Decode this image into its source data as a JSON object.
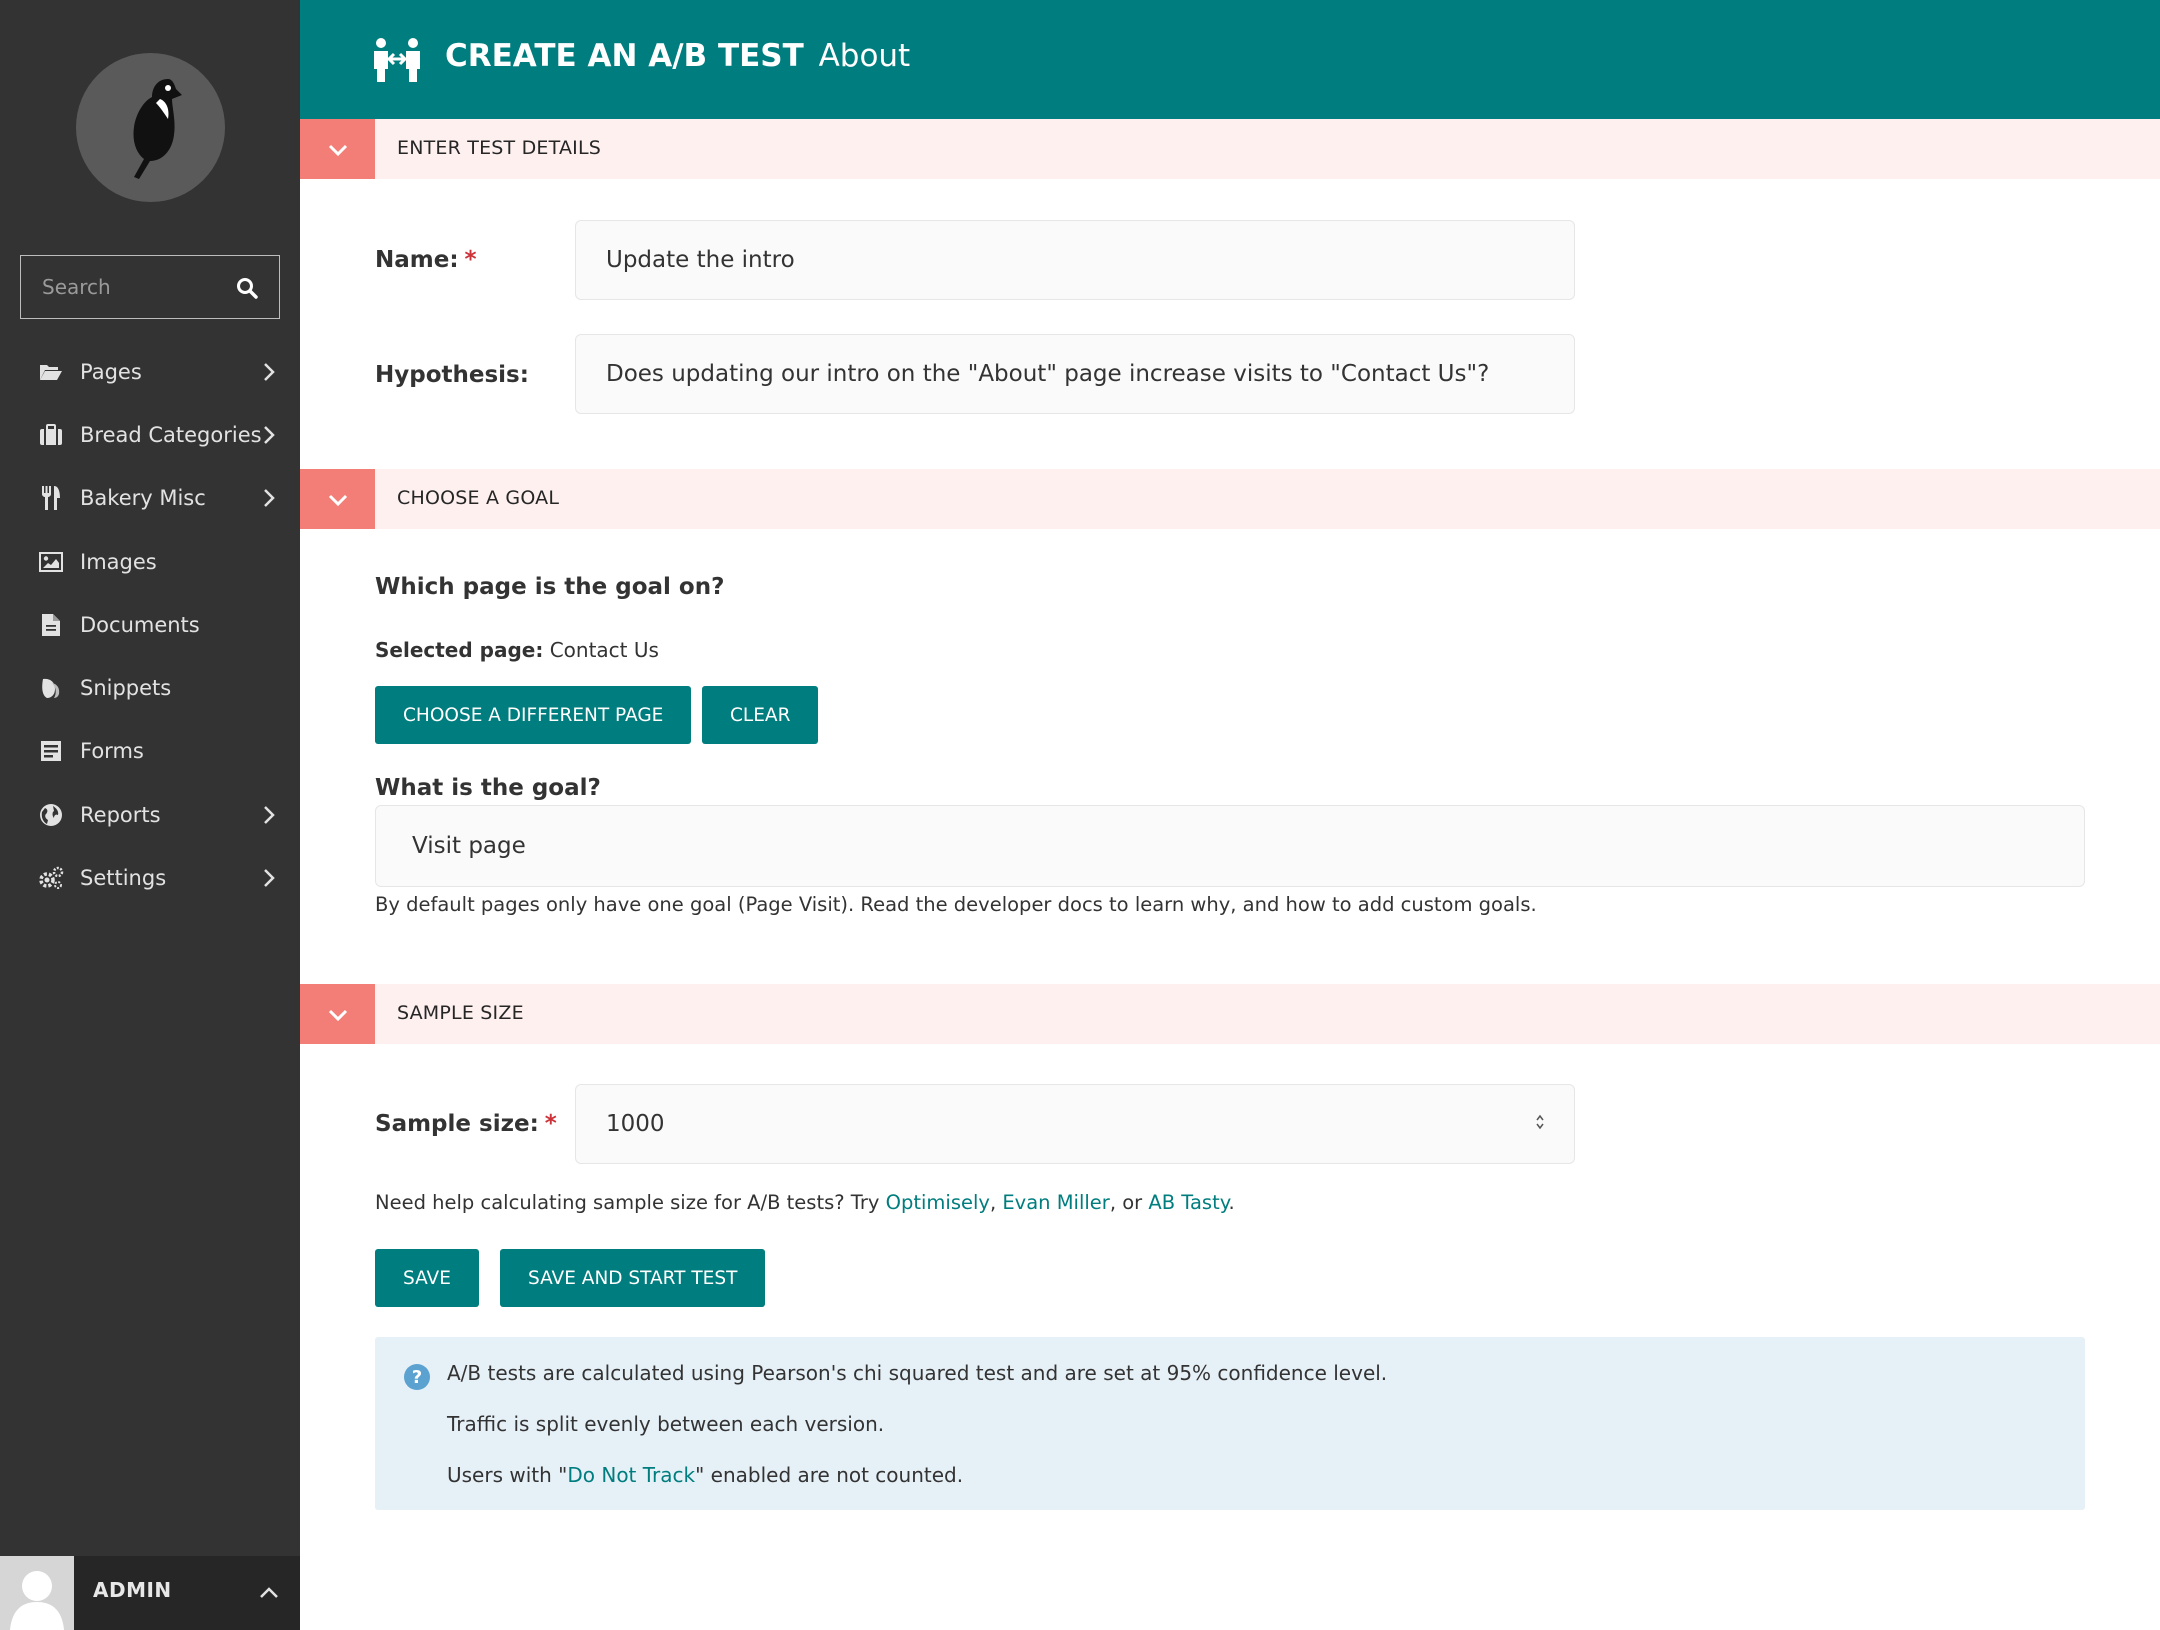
{
  "sidebar": {
    "search_placeholder": "Search",
    "items": [
      {
        "label": "Pages",
        "icon": "folder-open-icon",
        "has_submenu": true
      },
      {
        "label": "Bread Categories",
        "icon": "suitcase-icon",
        "has_submenu": true
      },
      {
        "label": "Bakery Misc",
        "icon": "cutlery-icon",
        "has_submenu": true
      },
      {
        "label": "Images",
        "icon": "image-icon",
        "has_submenu": false
      },
      {
        "label": "Documents",
        "icon": "document-icon",
        "has_submenu": false
      },
      {
        "label": "Snippets",
        "icon": "snippet-icon",
        "has_submenu": false
      },
      {
        "label": "Forms",
        "icon": "form-icon",
        "has_submenu": false
      },
      {
        "label": "Reports",
        "icon": "globe-icon",
        "has_submenu": true
      },
      {
        "label": "Settings",
        "icon": "cogs-icon",
        "has_submenu": true
      }
    ],
    "user": {
      "name": "ADMIN"
    }
  },
  "header": {
    "title": "CREATE AN A/B TEST",
    "subtitle": "About",
    "icon": "ab-test-icon"
  },
  "sections": {
    "details": {
      "title": "ENTER TEST DETAILS"
    },
    "goal": {
      "title": "CHOOSE A GOAL"
    },
    "sample": {
      "title": "SAMPLE SIZE"
    }
  },
  "form": {
    "name_label": "Name:",
    "name_value": "Update the intro",
    "hypothesis_label": "Hypothesis:",
    "hypothesis_value": "Does updating our intro on the \"About\" page increase visits to \"Contact Us\"?",
    "required_marker": "*",
    "goal_question": "Which page is the goal on?",
    "selected_page_label": "Selected page:",
    "selected_page_value": "Contact Us",
    "choose_page_button": "CHOOSE A DIFFERENT PAGE",
    "clear_button": "CLEAR",
    "goal_what_label": "What is the goal?",
    "goal_value": "Visit page",
    "goal_help": "By default pages only have one goal (Page Visit). Read the developer docs to learn why, and how to add custom goals.",
    "sample_label": "Sample size:",
    "sample_value": "1000",
    "sample_help_prefix": "Need help calculating sample size for A/B tests? Try ",
    "sample_help_link1": "Optimisely",
    "sample_help_sep1": ", ",
    "sample_help_link2": "Evan Miller",
    "sample_help_sep2": ", or ",
    "sample_help_link3": "AB Tasty",
    "sample_help_suffix": ".",
    "save_button": "SAVE",
    "save_start_button": "SAVE AND START TEST"
  },
  "info": {
    "line1": "A/B tests are calculated using Pearson's chi squared test and are set at 95% confidence level.",
    "line2": "Traffic is split evenly between each version.",
    "line3_prefix": "Users with \"",
    "line3_link": "Do Not Track",
    "line3_suffix": "\" enabled are not counted."
  },
  "colors": {
    "sidebar_bg": "#333333",
    "header_bg": "#007d7e",
    "accent": "#007d7e",
    "section_bg": "#fdf0ef",
    "section_toggle": "#f37e77",
    "info_bg": "#e6f0f7"
  }
}
